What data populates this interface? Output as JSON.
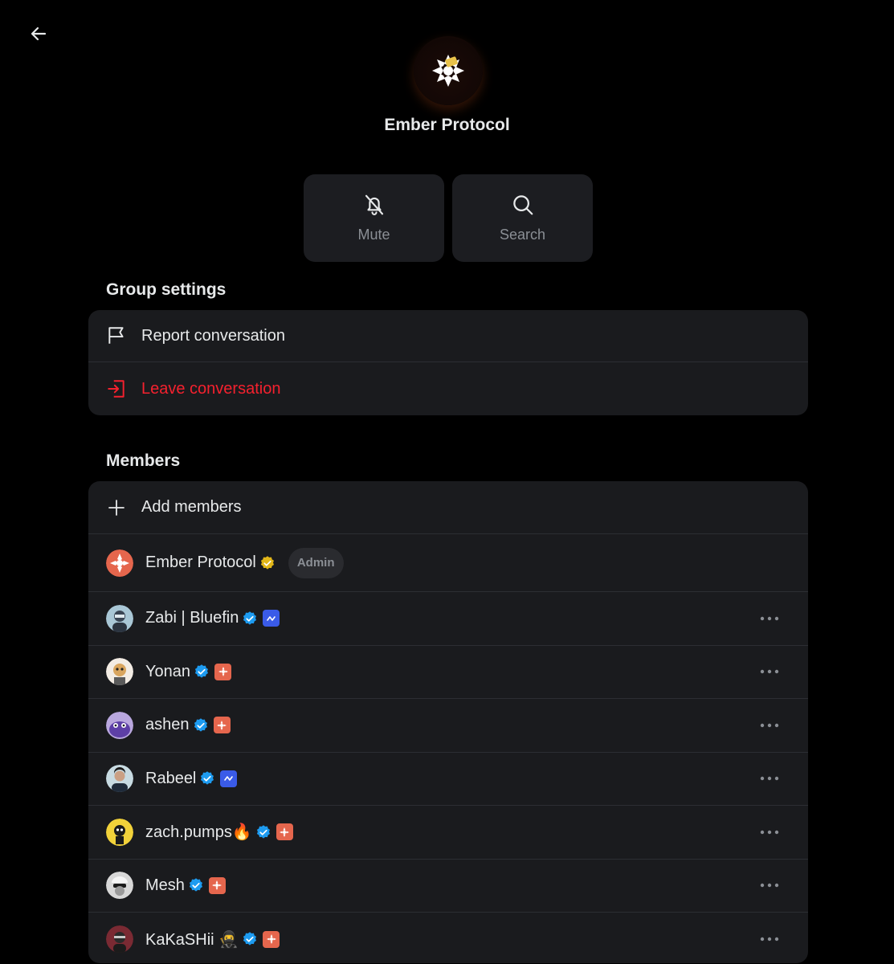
{
  "header": {
    "group_name": "Ember Protocol"
  },
  "actions": {
    "mute_label": "Mute",
    "search_label": "Search"
  },
  "group_settings": {
    "title": "Group settings",
    "report_label": "Report conversation",
    "leave_label": "Leave conversation"
  },
  "members": {
    "title": "Members",
    "add_label": "Add members",
    "admin_badge": "Admin",
    "list": [
      {
        "name": "Ember Protocol",
        "verified": "gold",
        "role": "Admin"
      },
      {
        "name": "Zabi | Bluefin",
        "verified": "blue",
        "affiliate": "bluefin"
      },
      {
        "name": "Yonan",
        "verified": "blue",
        "affiliate": "ember"
      },
      {
        "name": "ashen",
        "verified": "blue",
        "affiliate": "ember"
      },
      {
        "name": "Rabeel",
        "verified": "blue",
        "affiliate": "bluefin"
      },
      {
        "name": "zach.pumps🔥",
        "verified": "blue",
        "affiliate": "ember"
      },
      {
        "name": "Mesh",
        "verified": "blue",
        "affiliate": "ember"
      },
      {
        "name": "KaKaSHii 🥷",
        "verified": "blue",
        "affiliate": "ember"
      }
    ]
  },
  "colors": {
    "background": "#000000",
    "card": "#1a1b1e",
    "danger": "#f4212e",
    "verified_blue": "#1d9bf0",
    "verified_gold": "#e2b719",
    "ember_accent": "#e5664d",
    "bluefin_accent": "#3a5be8"
  }
}
